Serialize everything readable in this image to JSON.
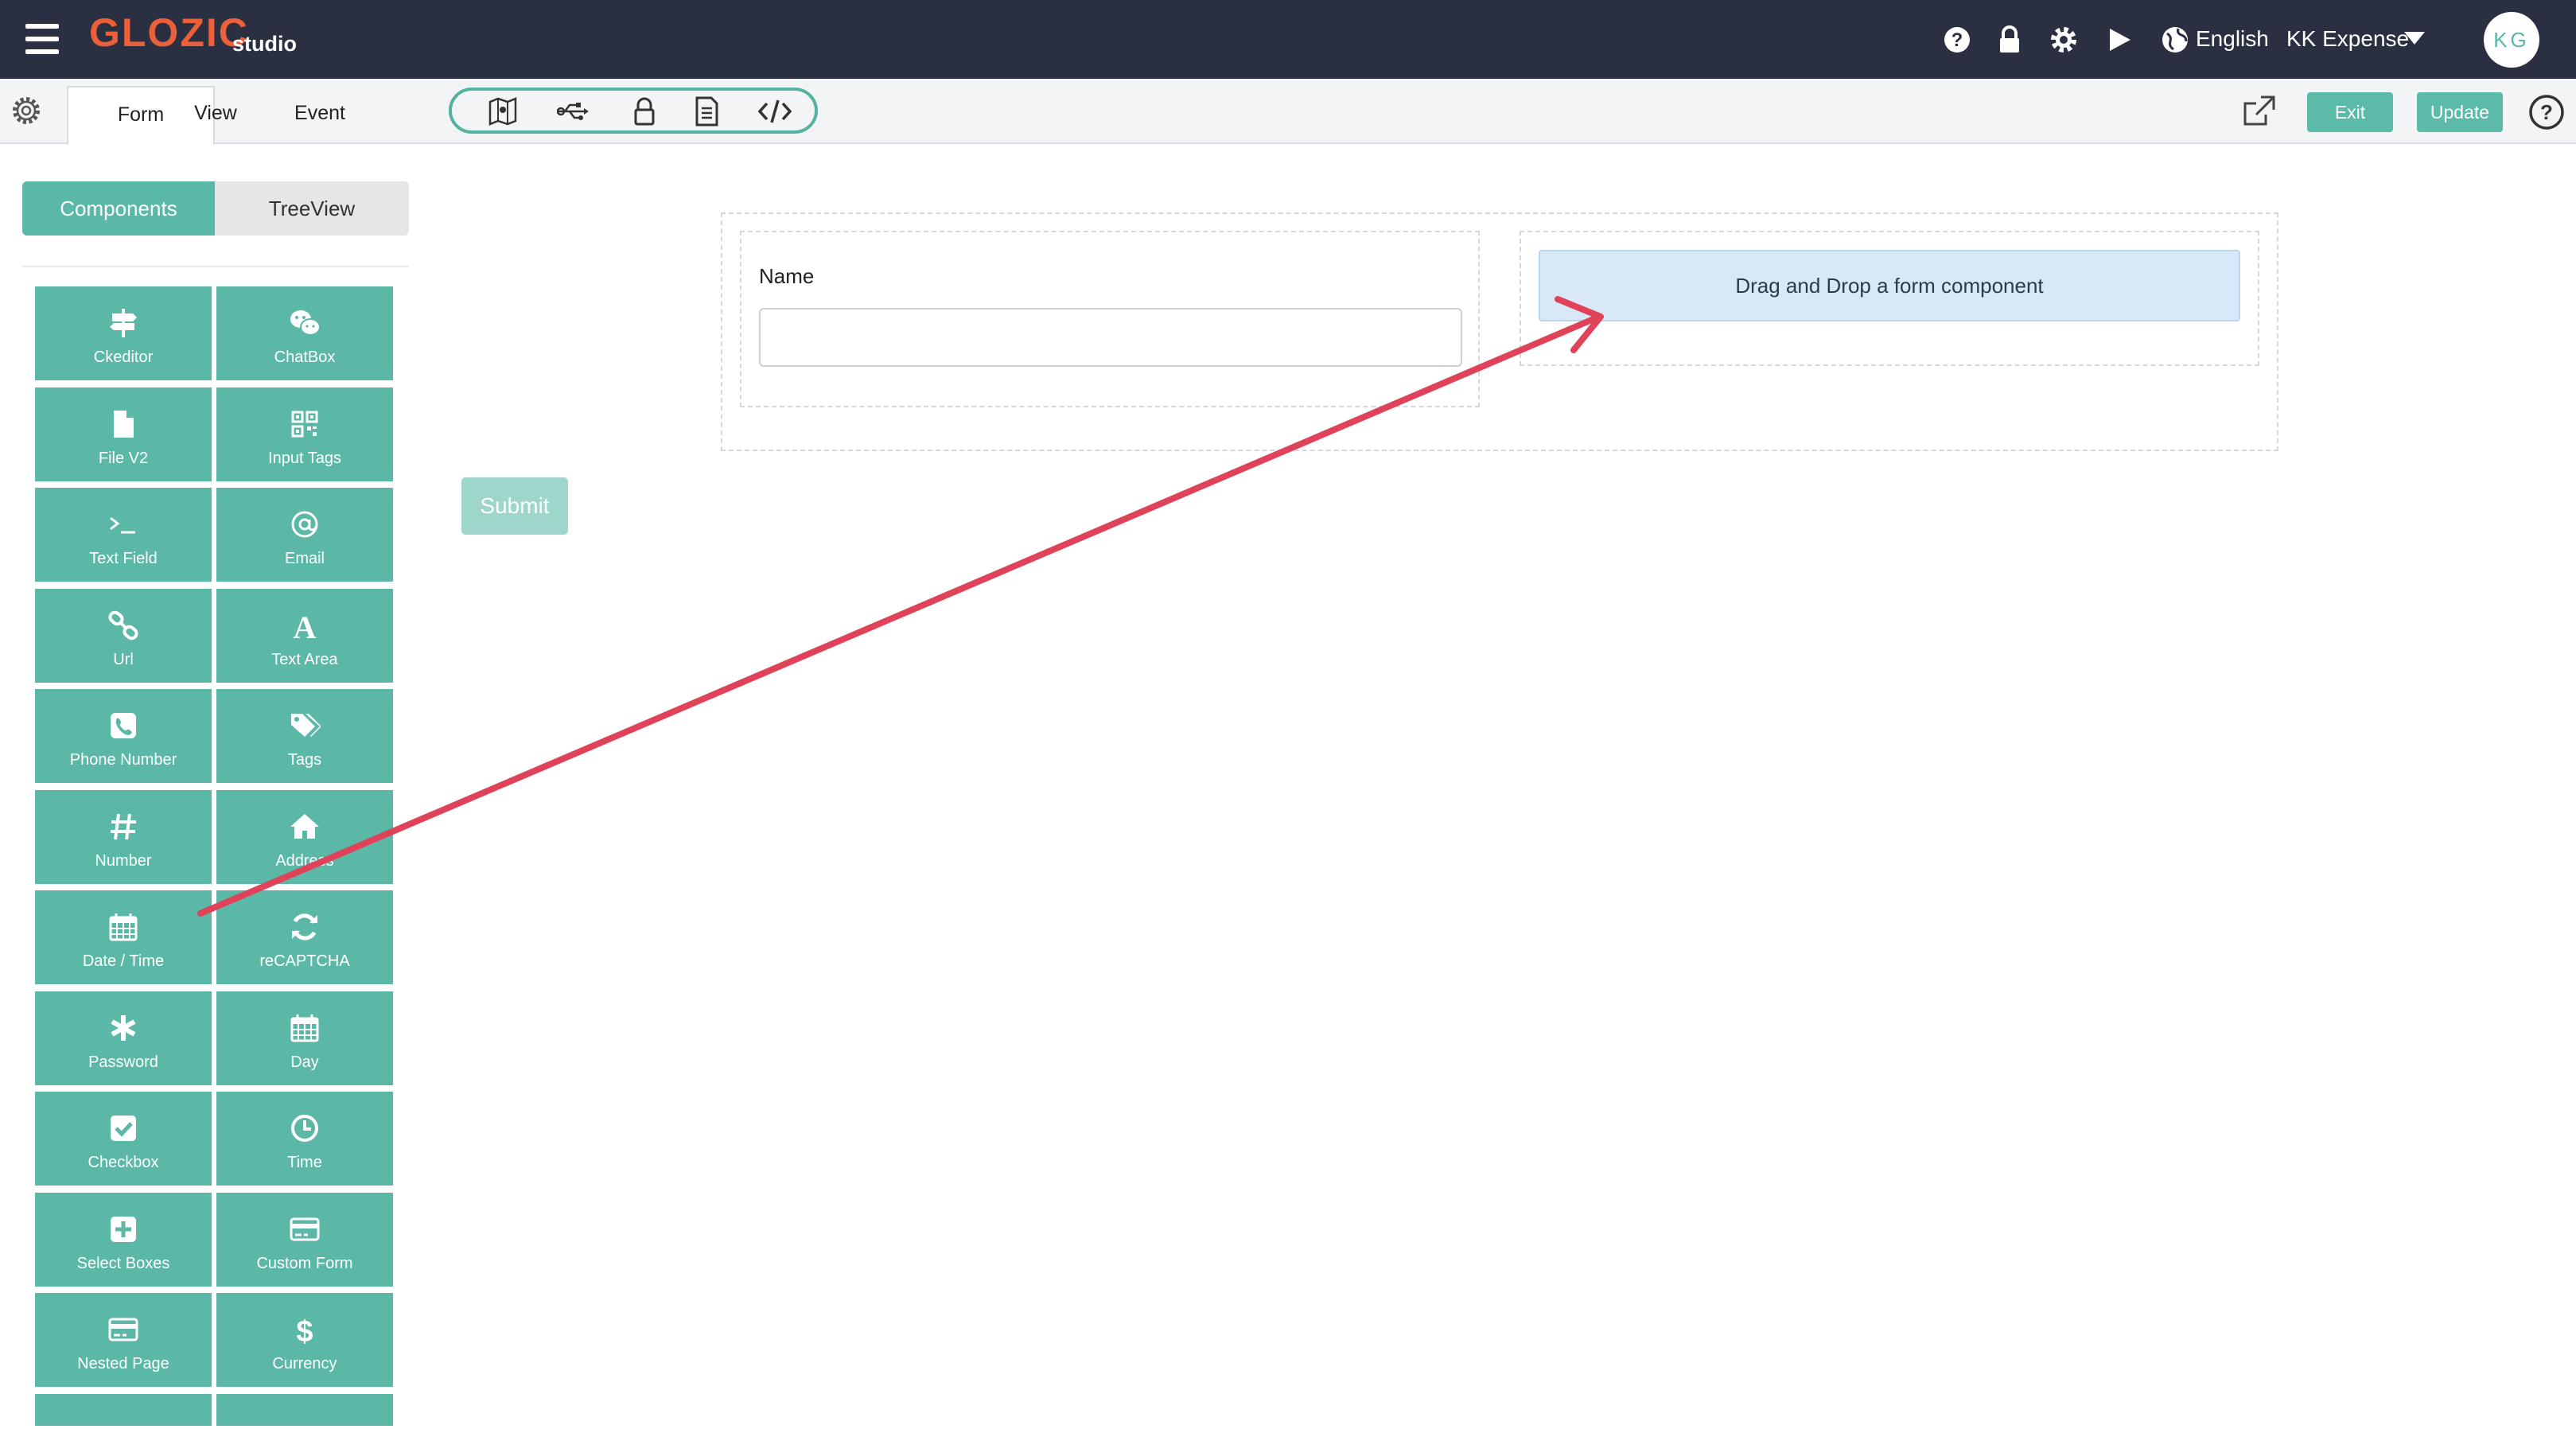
{
  "header": {
    "logo": "GLOZIC",
    "logo_sub": "studio",
    "language": "English",
    "project": "KK Expense",
    "avatar_initials": "KG",
    "icons": [
      "menu-icon",
      "help-icon",
      "lock-icon",
      "gear-icon",
      "play-icon",
      "globe-icon",
      "caret-down-icon"
    ]
  },
  "toolbar": {
    "tabs": [
      "Form",
      "View",
      "Event"
    ],
    "active_tab": "Form",
    "tool_icons": [
      "map-icon",
      "usb-icon",
      "lock-icon",
      "document-icon",
      "code-icon"
    ],
    "exit_label": "Exit",
    "update_label": "Update"
  },
  "panel": {
    "tab_components": "Components",
    "tab_treeview": "TreeView",
    "components": [
      {
        "label": "Ckeditor",
        "icon": "signpost-icon"
      },
      {
        "label": "ChatBox",
        "icon": "wechat-icon"
      },
      {
        "label": "File V2",
        "icon": "file-icon"
      },
      {
        "label": "Input Tags",
        "icon": "qrcode-icon"
      },
      {
        "label": "Text Field",
        "icon": "terminal-icon"
      },
      {
        "label": "Email",
        "icon": "at-icon"
      },
      {
        "label": "Url",
        "icon": "link-icon"
      },
      {
        "label": "Text Area",
        "icon": "font-icon"
      },
      {
        "label": "Phone Number",
        "icon": "phone-icon"
      },
      {
        "label": "Tags",
        "icon": "tags-icon"
      },
      {
        "label": "Number",
        "icon": "hash-icon"
      },
      {
        "label": "Address",
        "icon": "home-icon"
      },
      {
        "label": "Date / Time",
        "icon": "calendar-icon"
      },
      {
        "label": "reCAPTCHA",
        "icon": "refresh-icon"
      },
      {
        "label": "Password",
        "icon": "asterisk-icon"
      },
      {
        "label": "Day",
        "icon": "calendar-icon"
      },
      {
        "label": "Checkbox",
        "icon": "checkbox-icon"
      },
      {
        "label": "Time",
        "icon": "clock-icon"
      },
      {
        "label": "Select Boxes",
        "icon": "plus-square-icon"
      },
      {
        "label": "Custom Form",
        "icon": "credit-card-icon"
      },
      {
        "label": "Nested Page",
        "icon": "credit-card-icon"
      },
      {
        "label": "Currency",
        "icon": "dollar-icon"
      }
    ]
  },
  "canvas": {
    "field_label": "Name",
    "field_value": "",
    "dropzone_text": "Drag and Drop a form component",
    "submit_label": "Submit"
  },
  "colors": {
    "header_bg": "#2a3042",
    "accent_teal": "#5bb7a6",
    "logo_orange": "#e9603a",
    "arrow_red": "#e0425a",
    "dropzone_bg": "#d9e8f7"
  }
}
